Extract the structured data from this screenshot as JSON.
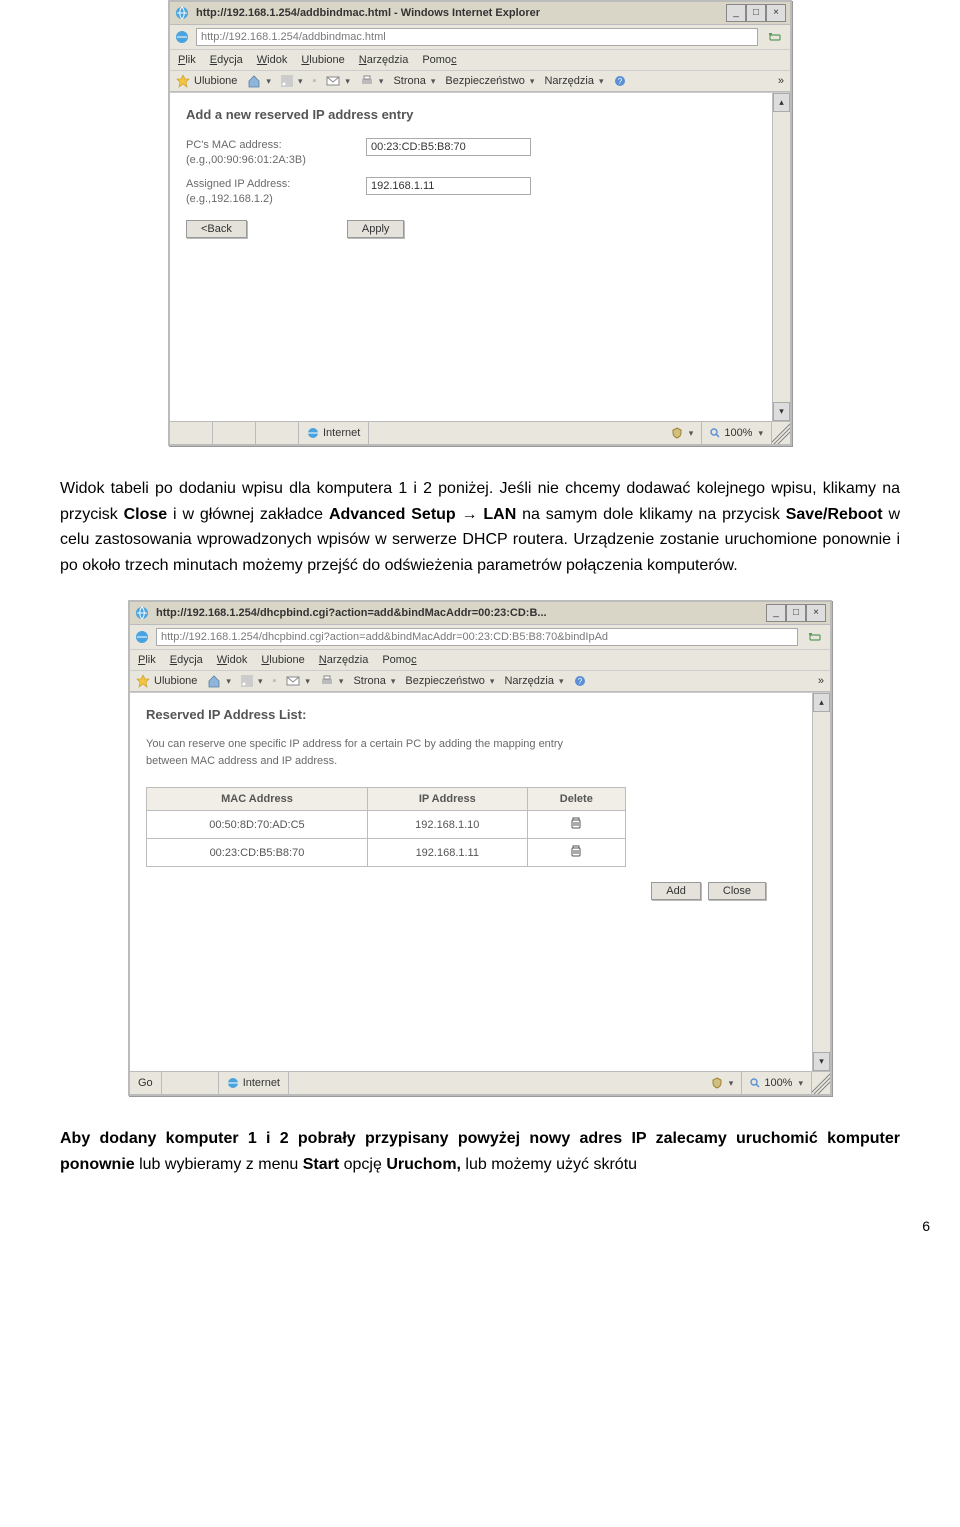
{
  "document": {
    "para1": "Widok tabeli po dodaniu wpisu dla komputera 1 i 2 poniżej. Jeśli nie chcemy dodawać kolejnego wpisu, klikamy na przycisk ",
    "para1_b1": "Close",
    "para1_mid1": " i w głównej zakładce ",
    "para1_b2": "Advanced Setup",
    "para1_arrow": " → ",
    "para1_b3": "LAN",
    "para1_mid2": " na samym dole klikamy na przycisk ",
    "para1_b4": "Save/Reboot",
    "para1_end": " w celu zastosowania wprowadzonych wpisów w serwerze DHCP routera. Urządzenie zostanie uruchomione ponownie i po około trzech minutach możemy przejść do odświeżenia parametrów połączenia komputerów.",
    "para2_a": "Aby dodany komputer 1 i 2 pobrały przypisany powyżej nowy adres IP zalecamy uruchomić komputer ponownie",
    "para2_mid1": " lub wybieramy z menu ",
    "para2_b1": "Start",
    "para2_mid2": " opcję ",
    "para2_b2": "Uruchom,",
    "para2_end": " lub możemy użyć skrótu",
    "page_number": "6"
  },
  "ie1": {
    "title": "http://192.168.1.254/addbindmac.html - Windows Internet Explorer",
    "addr": "http://192.168.1.254/addbindmac.html",
    "menus": {
      "plik": "Plik",
      "edycja": "Edycja",
      "widok": "Widok",
      "ulubione": "Ulubione",
      "narzedzia": "Narzędzia",
      "pomoc": "Pomoc"
    },
    "fav_label": "Ulubione",
    "tb": {
      "strona": "Strona",
      "bezp": "Bezpieczeństwo",
      "narz": "Narzędzia"
    },
    "section_title": "Add a new reserved IP address entry",
    "mac_label_l1": "PC's MAC address:",
    "mac_label_l2": "(e.g.,00:90:96:01:2A:3B)",
    "ip_label_l1": "Assigned IP Address:",
    "ip_label_l2": "(e.g.,192.168.1.2)",
    "mac_value": "00:23:CD:B5:B8:70",
    "ip_value": "192.168.1.11",
    "back_btn": "<Back",
    "apply_btn": "Apply",
    "status": {
      "zone": "Internet",
      "zoom": "100%"
    }
  },
  "ie2": {
    "title": "http://192.168.1.254/dhcpbind.cgi?action=add&bindMacAddr=00:23:CD:B...",
    "addr": "http://192.168.1.254/dhcpbind.cgi?action=add&bindMacAddr=00:23:CD:B5:B8:70&bindIpAd",
    "menus": {
      "plik": "Plik",
      "edycja": "Edycja",
      "widok": "Widok",
      "ulubione": "Ulubione",
      "narzedzia": "Narzędzia",
      "pomoc": "Pomoc"
    },
    "fav_label": "Ulubione",
    "tb": {
      "strona": "Strona",
      "bezp": "Bezpieczeństwo",
      "narz": "Narzędzia"
    },
    "list_title": "Reserved IP Address List:",
    "list_desc_l1": "You can reserve one specific IP address for a certain PC by adding the mapping entry",
    "list_desc_l2": "between MAC address and IP address.",
    "th_mac": "MAC Address",
    "th_ip": "IP Address",
    "th_del": "Delete",
    "rows": [
      {
        "mac": "00:50:8D:70:AD:C5",
        "ip": "192.168.1.10"
      },
      {
        "mac": "00:23:CD:B5:B8:70",
        "ip": "192.168.1.11"
      }
    ],
    "add_btn": "Add",
    "close_btn": "Close",
    "status": {
      "go": "Go",
      "zone": "Internet",
      "zoom": "100%"
    }
  }
}
